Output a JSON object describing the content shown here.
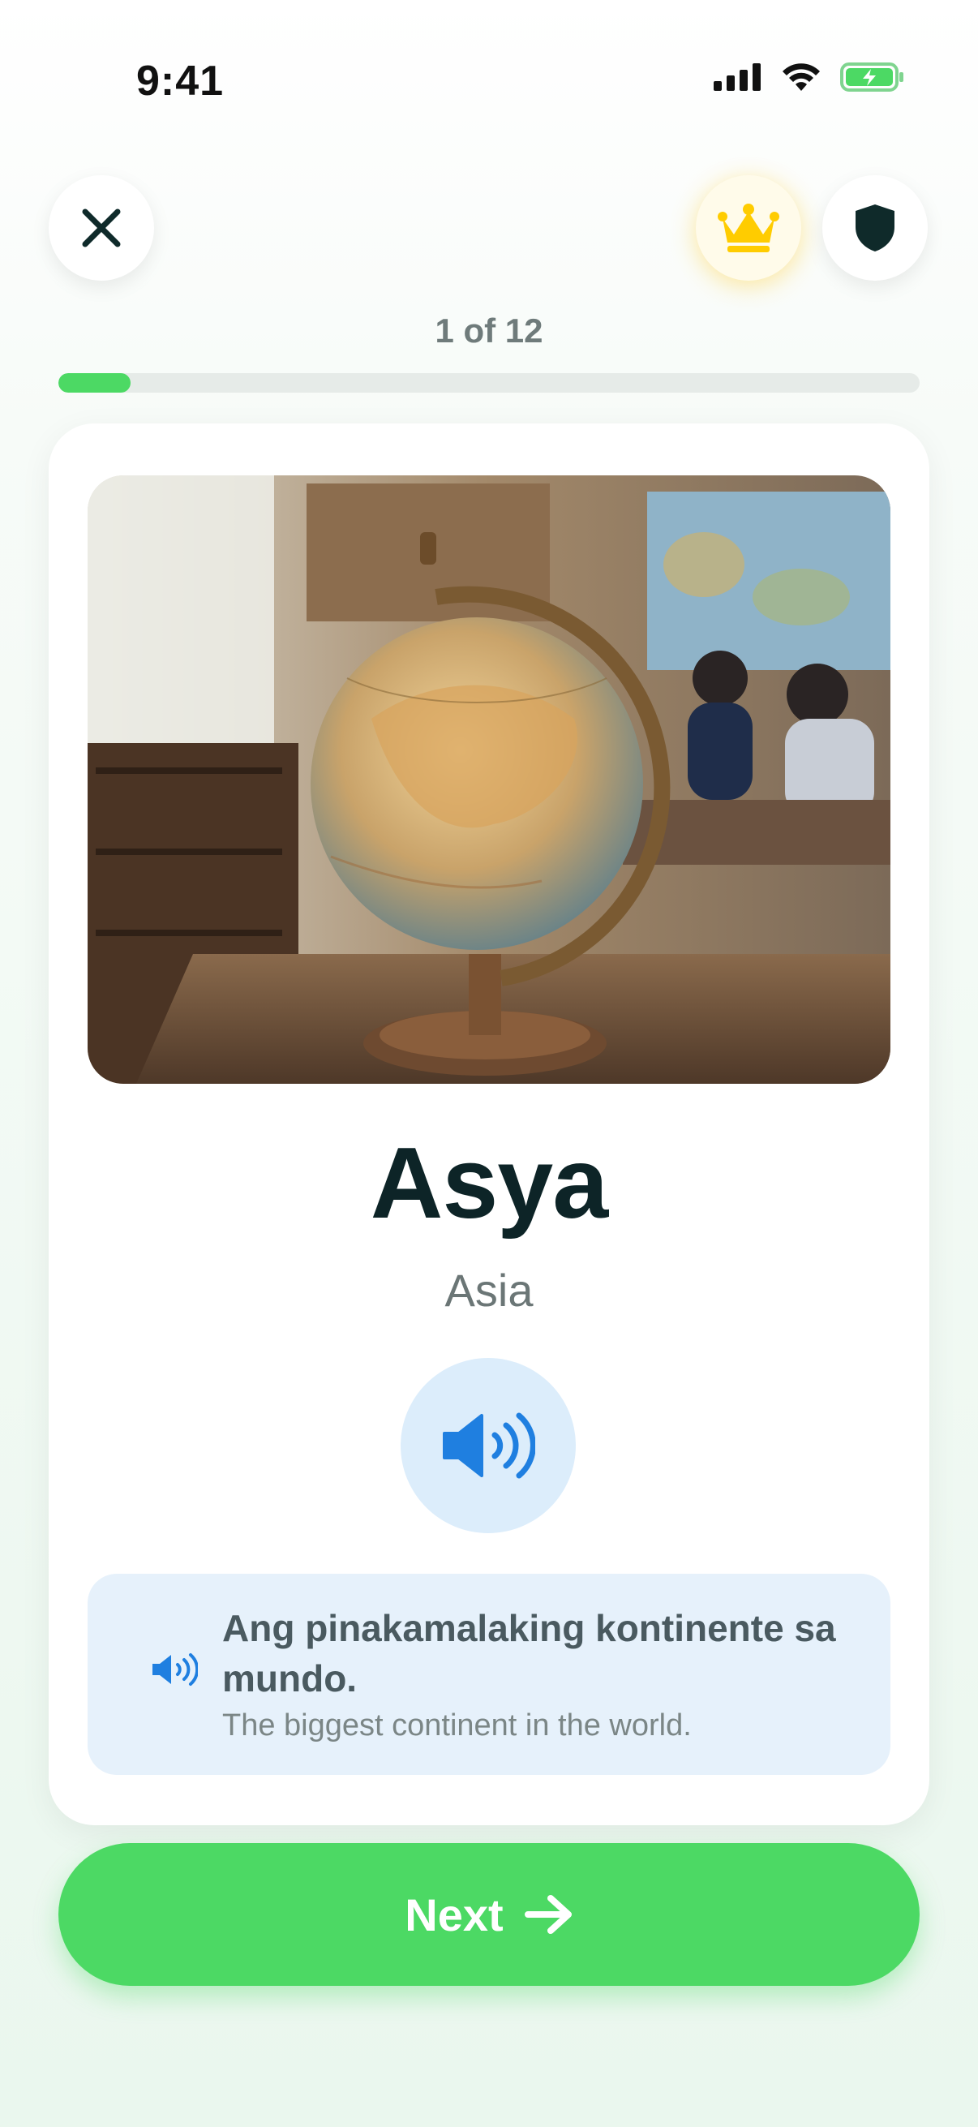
{
  "status": {
    "time": "9:41"
  },
  "header": {
    "close_icon": "close-icon",
    "premium_icon": "crown-icon",
    "shield_icon": "shield-icon"
  },
  "progress": {
    "label": "1 of 12",
    "current": 1,
    "total": 12
  },
  "card": {
    "image_subject": "globe on a classroom desk",
    "word": "Asya",
    "translation": "Asia",
    "example": {
      "text": "Ang pinakamalaking kontinente sa mundo.",
      "translation": "The biggest continent in the world."
    }
  },
  "next_button": {
    "label": "Next"
  },
  "colors": {
    "accent_green": "#4cd964",
    "audio_blue": "#1f7fe0",
    "audio_bg": "#dcedfb",
    "example_bg": "#e6f1fb",
    "crown_yellow": "#ffcc00"
  }
}
